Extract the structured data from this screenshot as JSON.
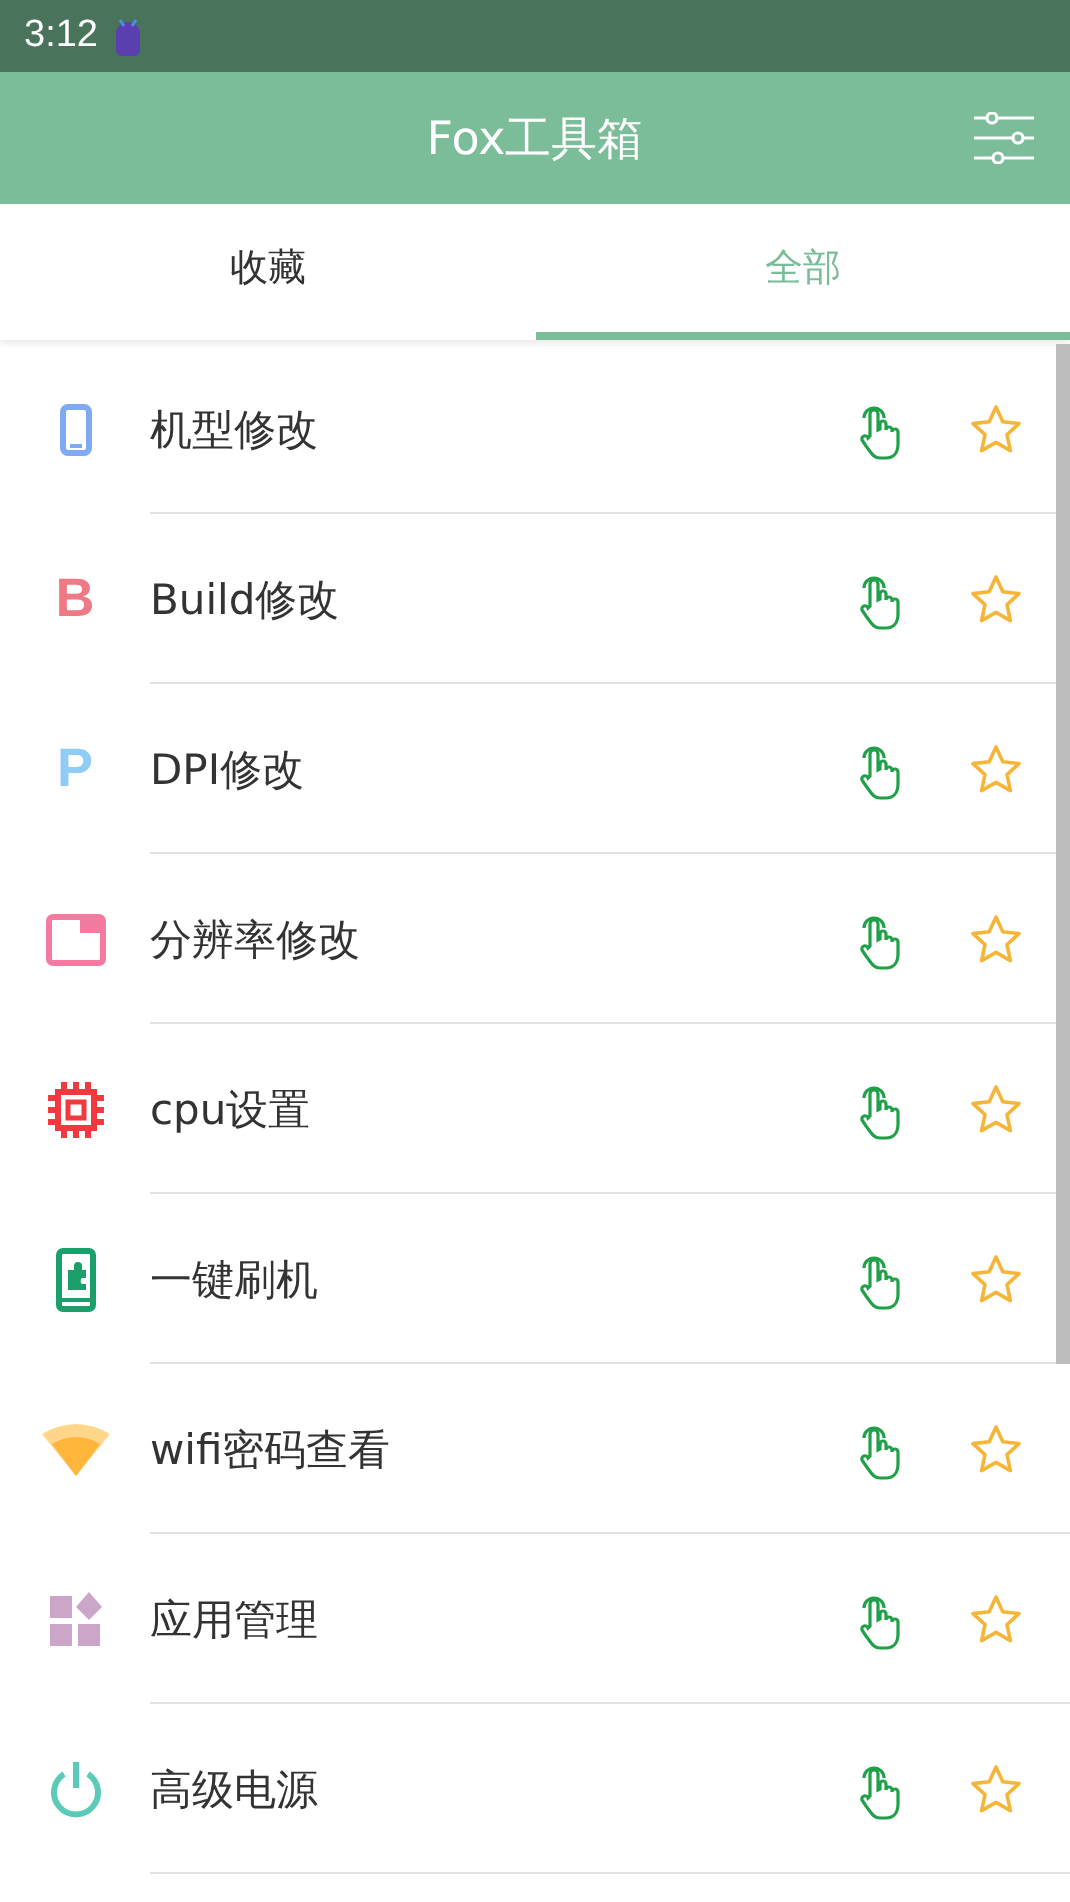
{
  "status_bar": {
    "time": "3:12"
  },
  "app_bar": {
    "title": "Fox工具箱"
  },
  "tabs": [
    {
      "label": "收藏",
      "selected": false
    },
    {
      "label": "全部",
      "selected": true
    }
  ],
  "tools": [
    {
      "kind": "phone",
      "label": "机型修改",
      "favorite": false
    },
    {
      "kind": "letter",
      "glyph": "B",
      "color": "#ef7a85",
      "label": "Build修改",
      "favorite": false
    },
    {
      "kind": "letter",
      "glyph": "P",
      "color": "#8fcdf7",
      "label": "DPI修改",
      "favorite": false
    },
    {
      "kind": "screen",
      "label": "分辨率修改",
      "favorite": false
    },
    {
      "kind": "chip",
      "label": "cpu设置",
      "favorite": false
    },
    {
      "kind": "flash",
      "label": "一键刷机",
      "favorite": false
    },
    {
      "kind": "wifi",
      "label": "wifi密码查看",
      "favorite": false
    },
    {
      "kind": "apps",
      "label": "应用管理",
      "favorite": false
    },
    {
      "kind": "power",
      "label": "高级电源",
      "favorite": false
    }
  ]
}
